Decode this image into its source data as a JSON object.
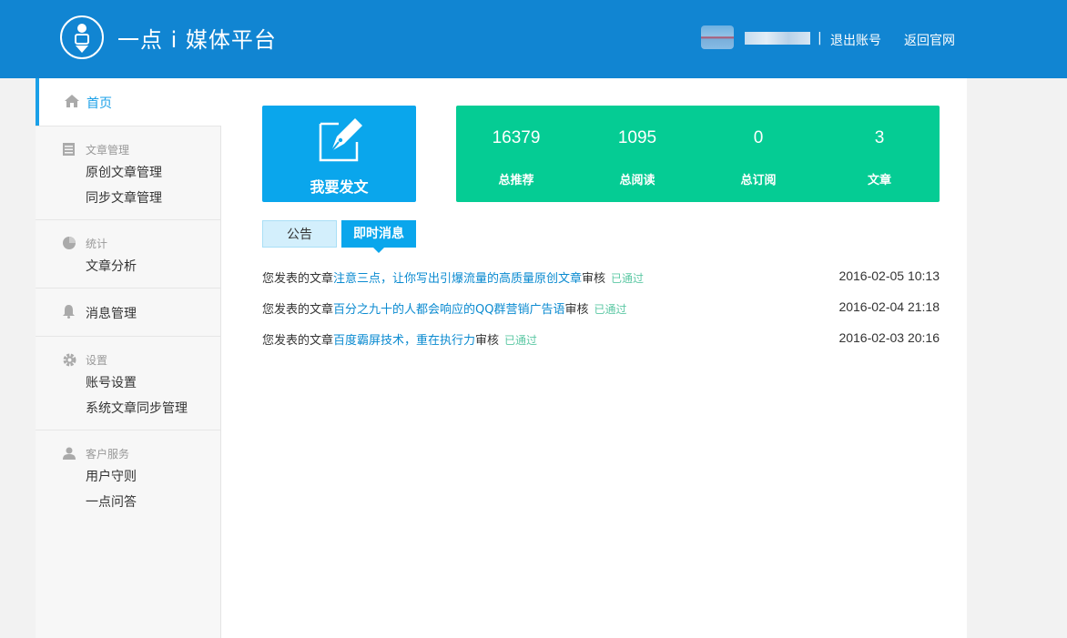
{
  "header": {
    "brand": "一点 i 媒体平台",
    "separator": "|",
    "logout": "退出账号",
    "home": "返回官网"
  },
  "sidebar": {
    "home": "首页",
    "groups": [
      {
        "title": "文章管理",
        "icon": "document-icon",
        "items": [
          "原创文章管理",
          "同步文章管理"
        ]
      },
      {
        "title": "统计",
        "icon": "pie-chart-icon",
        "items": [
          "文章分析"
        ]
      },
      {
        "title": "消息管理",
        "icon": "bell-icon",
        "items": []
      },
      {
        "title": "设置",
        "icon": "gear-icon",
        "items": [
          "账号设置",
          "系统文章同步管理"
        ]
      },
      {
        "title": "客户服务",
        "icon": "user-icon",
        "items": [
          "用户守则",
          "一点问答"
        ]
      }
    ]
  },
  "post_card": {
    "label": "我要发文",
    "icon": "pen-edit-icon"
  },
  "stats": [
    {
      "value": "16379",
      "label": "总推荐"
    },
    {
      "value": "1095",
      "label": "总阅读"
    },
    {
      "value": "0",
      "label": "总订阅"
    },
    {
      "value": "3",
      "label": "文章"
    }
  ],
  "tabs": {
    "notice": "公告",
    "messages": "即时消息"
  },
  "messages": [
    {
      "prefix": "您发表的文章",
      "title": "注意三点，让你写出引爆流量的高质量原创文章",
      "suffix": "审核",
      "status": "已通过",
      "time": "2016-02-05 10:13"
    },
    {
      "prefix": "您发表的文章",
      "title": "百分之九十的人都会响应的QQ群营销广告语",
      "suffix": "审核",
      "status": "已通过",
      "time": "2016-02-04 21:18"
    },
    {
      "prefix": "您发表的文章",
      "title": "百度霸屏技术，重在执行力",
      "suffix": "审核",
      "status": "已通过",
      "time": "2016-02-03 20:16"
    }
  ],
  "colors": {
    "header": "#1185d2",
    "accent": "#0aa6ec",
    "stats": "#05cc94",
    "approved": "#5cc8a4"
  }
}
